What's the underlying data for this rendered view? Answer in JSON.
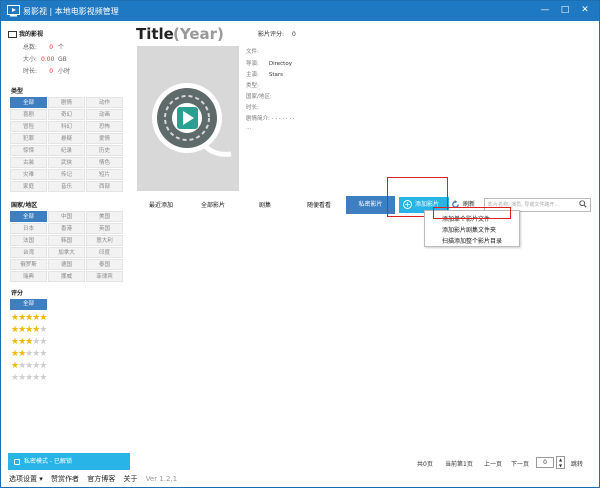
{
  "window": {
    "title": "易影视 | 本地电影视频管理",
    "minimize": "—",
    "maximize": "□",
    "close": "✕"
  },
  "stats": {
    "header": "我的影视",
    "rows": [
      {
        "label": "总数:",
        "value": "0",
        "unit": "个"
      },
      {
        "label": "大小:",
        "value": "0.00",
        "unit": "GB"
      },
      {
        "label": "时长:",
        "value": "0",
        "unit": "小时"
      }
    ]
  },
  "sections": {
    "type": "类型",
    "region": "国家/地区",
    "rating": "评分"
  },
  "types": [
    "全部",
    "剧情",
    "动作",
    "喜剧",
    "奇幻",
    "动画",
    "冒险",
    "科幻",
    "恐怖",
    "犯罪",
    "悬疑",
    "爱情",
    "惊悚",
    "纪录",
    "历史",
    "古装",
    "武侠",
    "情色",
    "灾难",
    "传记",
    "短片",
    "家庭",
    "音乐",
    "西部"
  ],
  "regions": [
    "全部",
    "中国",
    "美国",
    "日本",
    "香港",
    "英国",
    "法国",
    "韩国",
    "意大利",
    "台湾",
    "加拿大",
    "印度",
    "俄罗斯",
    "德国",
    "泰国",
    "瑞典",
    "挪威",
    "菲律宾"
  ],
  "rating_all": "全部",
  "star_rows": [
    5,
    4,
    3,
    2,
    1,
    0
  ],
  "privacy": "私密模式 - 已解锁",
  "menu": {
    "settings": "选项设置 ▾",
    "donate": "赞赏作者",
    "blog": "官方博客",
    "about": "关于",
    "version": "Ver 1.2.1"
  },
  "movie": {
    "title": "Title",
    "year": "(Year)",
    "rating_label": "影片评分:",
    "rating_value": "0",
    "fields": [
      {
        "label": "文件:",
        "value": ""
      },
      {
        "label": "导演:",
        "value": "Directoy"
      },
      {
        "label": "主演:",
        "value": "Stars"
      },
      {
        "label": "类型:",
        "value": ""
      },
      {
        "label": "国家/地区:",
        "value": ""
      },
      {
        "label": "时长:",
        "value": ""
      },
      {
        "label": "剧情简介:",
        "value": "· · · · · · ·"
      },
      {
        "label": "...",
        "value": ""
      }
    ]
  },
  "toolbar": {
    "recent": "最近添加",
    "all": "全部影片",
    "series": "剧集",
    "random": "随便看看",
    "private": "私密影片",
    "add": "添加影片",
    "refresh": "刷新",
    "search_placeholder": "影片名称, 演员, 导或文件路开..."
  },
  "dropdown": [
    "添加单个影片文件",
    "添加影片剧集文件夹",
    "扫描添加整个影片目录"
  ],
  "pager": {
    "total_pages": "共0页",
    "current": "当前第1页",
    "prev": "上一页",
    "next": "下一页",
    "page_value": "0",
    "jump": "跳转"
  },
  "colors": {
    "accent": "#3e7fc1",
    "titlebar": "#1e78c2",
    "button": "#29b4e8",
    "highlight": "#e02020",
    "star": "#f5b800"
  }
}
